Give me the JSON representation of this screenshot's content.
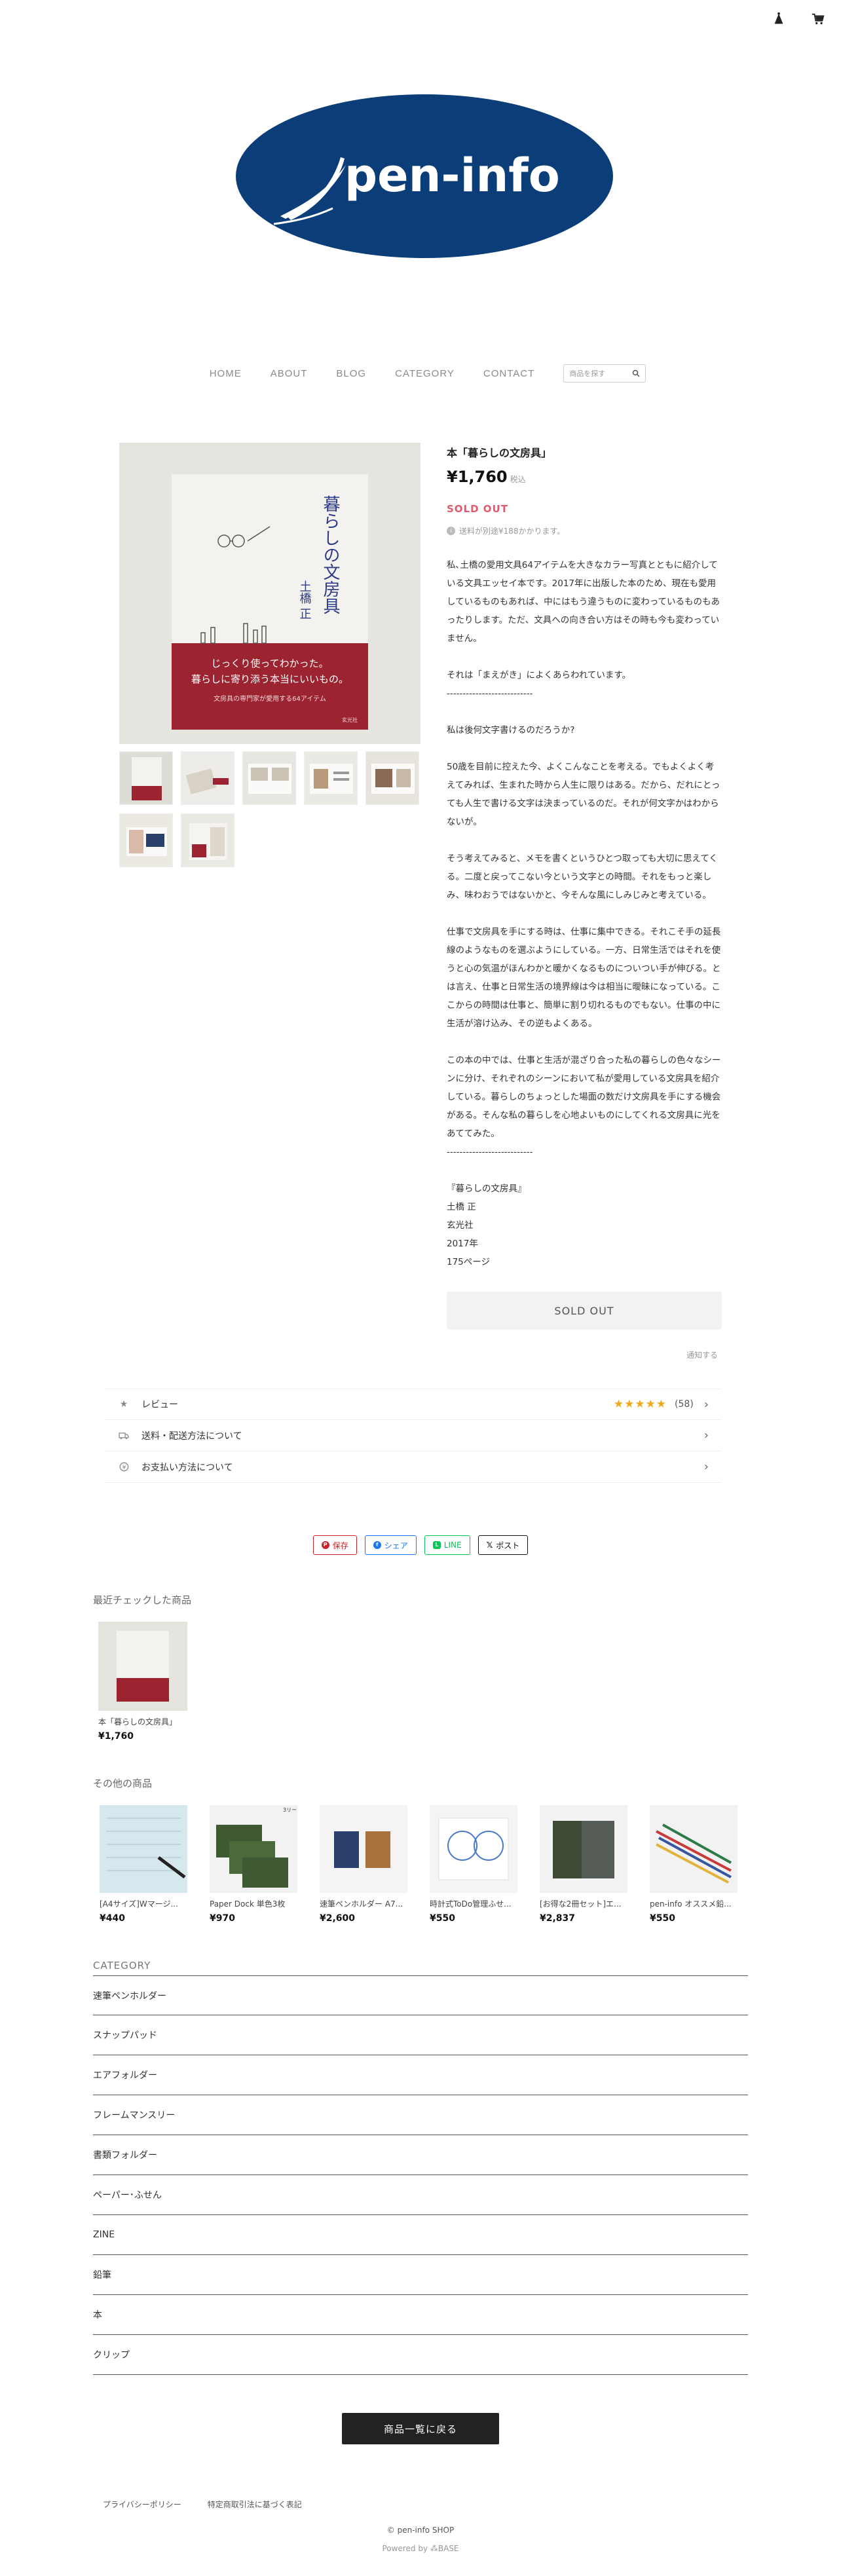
{
  "header": {
    "icons": [
      "account-icon",
      "cart-icon"
    ],
    "logo_text": "pen-info"
  },
  "nav": {
    "items": [
      "HOME",
      "ABOUT",
      "BLOG",
      "CATEGORY",
      "CONTACT"
    ],
    "search_placeholder": "商品を探す"
  },
  "product": {
    "title": "本「暮らしの文房具」",
    "price": "¥1,760",
    "tax_label": "税込",
    "status": "SOLD OUT",
    "shipping_note": "送料が別途¥188かかります。",
    "description": [
      "私､土橋の愛用文具64アイテムを大きなカラー写真とともに紹介している文具エッセイ本です。2017年に出版した本のため、現在も愛用しているものもあれば、中にはもう違うものに変わっているものもあったりします。ただ、文具への向き合い方はその時も今も変わっていません。",
      "それは「まえがき」によくあらわれています。",
      "---------------------------",
      "私は後何文字書けるのだろうか?",
      "50歳を目前に控えた今、よくこんなことを考える。でもよくよく考えてみれば、生まれた時から人生に限りはある。だから、だれにとっても人生で書ける文字は決まっているのだ。それが何文字かはわからないが。",
      "そう考えてみると、メモを書くというひとつ取っても大切に思えてくる。二度と戻ってこない今という文字との時間。それをもっと楽しみ、味わおうではないかと、今そんな風にしみじみと考えている。",
      "仕事で文房具を手にする時は、仕事に集中できる。それこそ手の延長線のようなものを選ぶようにしている。一方、日常生活ではそれを使うと心の気温がほんわかと暖かくなるものについつい手が伸びる。とは言え、仕事と日常生活の境界線は今は相当に曖昧になっている。ここからの時間は仕事と、簡単に割り切れるものでもない。仕事の中に生活が溶け込み、その逆もよくある。",
      "この本の中では、仕事と生活が混ざり合った私の暮らしの色々なシーンに分け、それぞれのシーンにおいて私が愛用している文房具を紹介している。暮らしのちょっとした場面の数だけ文房具を手にする機会がある。そんな私の暮らしを心地よいものにしてくれる文房具に光をあててみた。",
      "---------------------------"
    ],
    "meta": [
      "『暮らしの文房具』",
      "土橋 正",
      "玄光社",
      "2017年",
      "175ページ"
    ],
    "sold_button": "SOLD OUT",
    "notify_link": "通知する",
    "image_caption": {
      "spine_title": "暮らしの文房具",
      "author": "土橋 正",
      "band1": "じっくり使ってわかった。",
      "band2": "暮らしに寄り添う本当にいいもの。",
      "band3": "文房具の専門家が愛用する64アイテム",
      "publisher": "玄光社"
    }
  },
  "accordion": [
    {
      "label": "レビュー",
      "stars": "★★★★★",
      "count": "(58)"
    },
    {
      "label": "送料・配送方法について"
    },
    {
      "label": "お支払い方法について"
    }
  ],
  "share": {
    "save": "保存",
    "facebook": "シェア",
    "line": "LINE",
    "x": "ポスト"
  },
  "recent": {
    "title": "最近チェックした商品",
    "items": [
      {
        "name": "本「暮らしの文房具」",
        "price": "¥1,760"
      }
    ]
  },
  "others": {
    "title": "その他の商品",
    "items": [
      {
        "name": "[A4サイズ]Wマージ...",
        "price": "¥440"
      },
      {
        "name": "Paper Dock 単色3枚",
        "price": "¥970"
      },
      {
        "name": "速筆ペンホルダー A7...",
        "price": "¥2,600"
      },
      {
        "name": "時計式ToDo管理ふせ...",
        "price": "¥550"
      },
      {
        "name": "[お得な2冊セット]エ...",
        "price": "¥2,837"
      },
      {
        "name": "pen-info オススメ鉛...",
        "price": "¥550"
      }
    ],
    "badge": "3リーフ"
  },
  "category": {
    "title": "CATEGORY",
    "items": [
      "速筆ペンホルダー",
      "スナップパッド",
      "エアフォルダー",
      "フレームマンスリー",
      "書類フォルダー",
      "ペーパー･ふせん",
      "ZINE",
      "鉛筆",
      "本",
      "クリップ"
    ]
  },
  "back_button": "商品一覧に戻る",
  "footer": {
    "links": [
      "プライバシーポリシー",
      "特定商取引法に基づく表記"
    ],
    "copyright": "© pen-info SHOP",
    "powered": "Powered by",
    "powered_brand": "BASE"
  },
  "colors": {
    "logo_navy": "#0b3e78",
    "sold_pink": "#e0596c",
    "book_red": "#9c2430",
    "star": "#f0a81c"
  }
}
